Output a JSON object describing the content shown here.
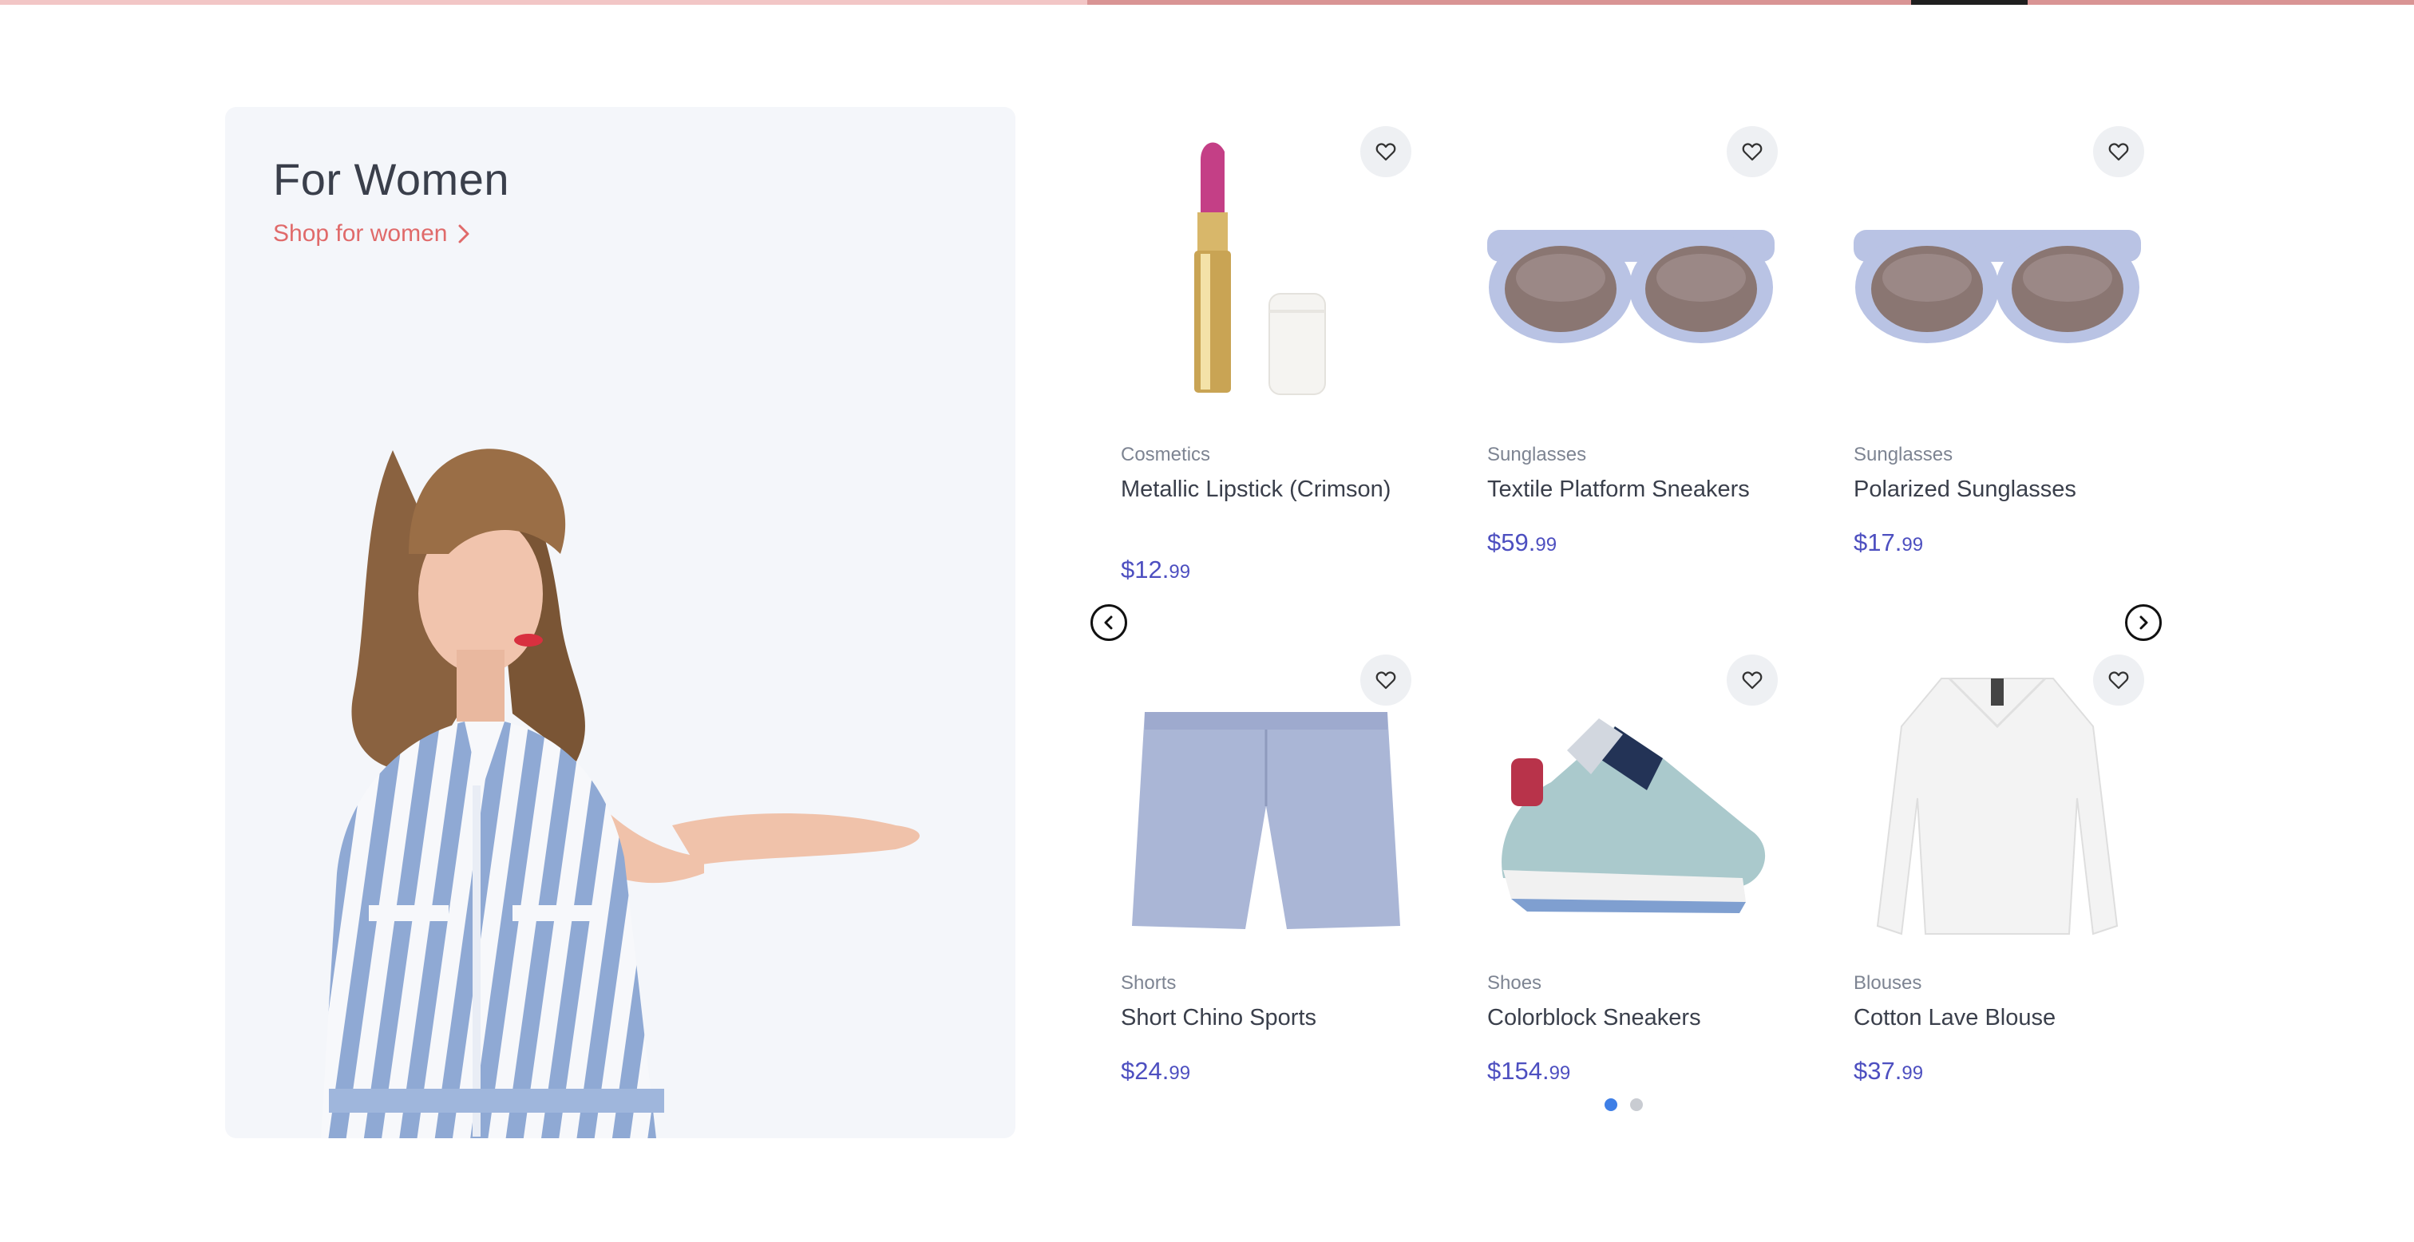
{
  "promo": {
    "title": "For Women",
    "link_label": "Shop for women"
  },
  "products": [
    {
      "category": "Cosmetics",
      "name": "Metallic Lipstick (Crimson)",
      "price_main": "$12.",
      "price_cents": "99",
      "image": "lipstick"
    },
    {
      "category": "Sunglasses",
      "name": "Textile Platform Sneakers",
      "price_main": "$59.",
      "price_cents": "99",
      "image": "sunglasses"
    },
    {
      "category": "Sunglasses",
      "name": "Polarized Sunglasses",
      "price_main": "$17.",
      "price_cents": "99",
      "image": "sunglasses"
    },
    {
      "category": "Shorts",
      "name": "Short Chino Sports",
      "price_main": "$24.",
      "price_cents": "99",
      "image": "shorts"
    },
    {
      "category": "Shoes",
      "name": "Colorblock Sneakers",
      "price_main": "$154.",
      "price_cents": "99",
      "image": "sneakers"
    },
    {
      "category": "Blouses",
      "name": "Cotton Lave Blouse",
      "price_main": "$37.",
      "price_cents": "99",
      "image": "blouse"
    }
  ],
  "carousel": {
    "prev_icon": "chevron-left-icon",
    "next_icon": "chevron-right-icon",
    "pages": 2,
    "active_page": 1
  },
  "colors": {
    "accent_link": "#e06a6a",
    "price": "#4d4fc0",
    "active_dot": "#3f7fe6"
  }
}
